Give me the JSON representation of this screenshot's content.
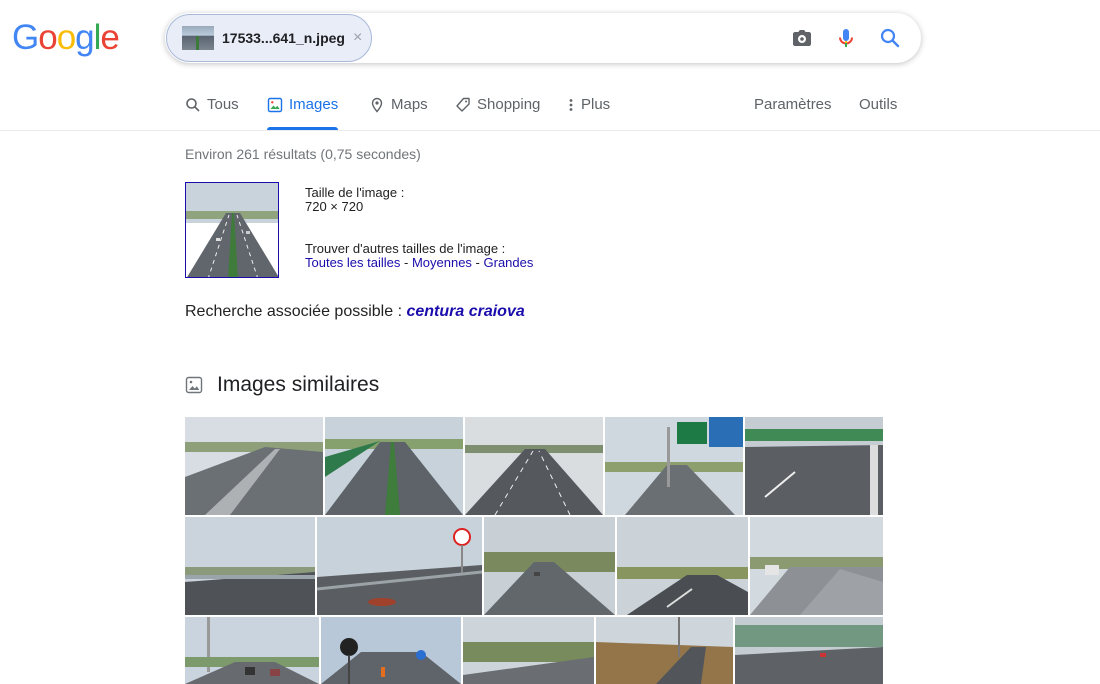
{
  "logo": [
    "G",
    "o",
    "o",
    "g",
    "l",
    "e"
  ],
  "logo_colors": [
    "#4285f4",
    "#ea4335",
    "#fbbc05",
    "#4285f4",
    "#34a853",
    "#ea4335"
  ],
  "search": {
    "chip_label": "17533...641_n.jpeg",
    "chip_close": "×",
    "icons": [
      "camera-icon",
      "mic-icon",
      "search-icon"
    ]
  },
  "tabs": [
    {
      "label": "Tous",
      "icon": "search-icon"
    },
    {
      "label": "Images",
      "icon": "image-icon",
      "active": true
    },
    {
      "label": "Maps",
      "icon": "map-pin-icon"
    },
    {
      "label": "Shopping",
      "icon": "tag-icon"
    },
    {
      "label": "Plus",
      "icon": "more-vert-icon"
    }
  ],
  "tabs_right": {
    "settings": "Paramètres",
    "tools": "Outils"
  },
  "results": {
    "stats": "Environ 261 résultats (0,75 secondes)",
    "size_label": "Taille de l'image :",
    "size_value": "720 × 720",
    "other_sizes_label": "Trouver d'autres tailles de l'image :",
    "link_all": "Toutes les tailles",
    "link_medium": "Moyennes",
    "link_large": "Grandes",
    "separator": " - ",
    "related_label": "Recherche associée possible :",
    "related_query": "centura craiova"
  },
  "similar": {
    "title": "Images similaires",
    "icon": "image-icon"
  },
  "accent": "#1a73e8",
  "link_color": "#1a0dab"
}
